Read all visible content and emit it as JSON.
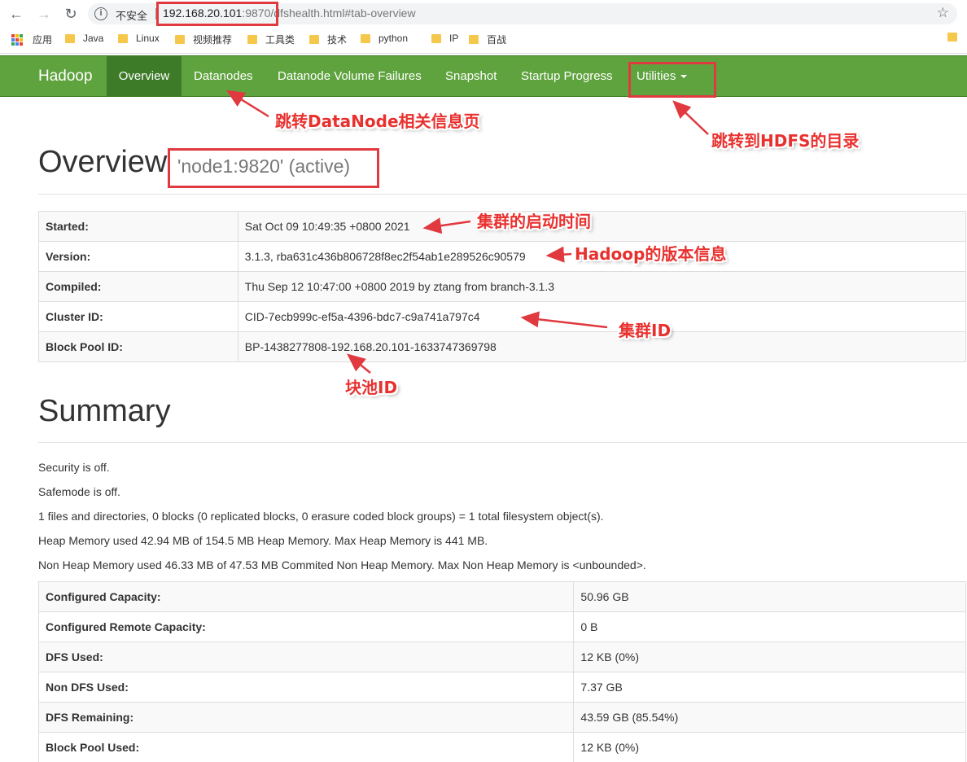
{
  "browser": {
    "insecure_label": "不安全",
    "url_host": "192.168.20.101",
    "url_port": ":9870",
    "url_path": "/dfshealth.html#tab-overview",
    "bookmarks": [
      "应用",
      "Java",
      "Linux",
      "视频推荐",
      "工具类",
      "技术",
      "python",
      "IP",
      "百战"
    ]
  },
  "navbar": {
    "brand": "Hadoop",
    "items": [
      "Overview",
      "Datanodes",
      "Datanode Volume Failures",
      "Snapshot",
      "Startup Progress",
      "Utilities"
    ],
    "active": "Overview"
  },
  "overview": {
    "title": "Overview",
    "subtitle": "'node1:9820' (active)",
    "rows": [
      {
        "key": "Started:",
        "value": "Sat Oct 09 10:49:35 +0800 2021"
      },
      {
        "key": "Version:",
        "value": "3.1.3, rba631c436b806728f8ec2f54ab1e289526c90579"
      },
      {
        "key": "Compiled:",
        "value": "Thu Sep 12 10:47:00 +0800 2019 by ztang from branch-3.1.3"
      },
      {
        "key": "Cluster ID:",
        "value": "CID-7ecb999c-ef5a-4396-bdc7-c9a741a797c4"
      },
      {
        "key": "Block Pool ID:",
        "value": "BP-1438277808-192.168.20.101-1633747369798"
      }
    ]
  },
  "summary": {
    "title": "Summary",
    "lines": [
      "Security is off.",
      "Safemode is off.",
      "1 files and directories, 0 blocks (0 replicated blocks, 0 erasure coded block groups) = 1 total filesystem object(s).",
      "Heap Memory used 42.94 MB of 154.5 MB Heap Memory. Max Heap Memory is 441 MB.",
      "Non Heap Memory used 46.33 MB of 47.53 MB Commited Non Heap Memory. Max Non Heap Memory is <unbounded>."
    ],
    "rows": [
      {
        "key": "Configured Capacity:",
        "value": "50.96 GB"
      },
      {
        "key": "Configured Remote Capacity:",
        "value": "0 B"
      },
      {
        "key": "DFS Used:",
        "value": "12 KB (0%)"
      },
      {
        "key": "Non DFS Used:",
        "value": "7.37 GB"
      },
      {
        "key": "DFS Remaining:",
        "value": "43.59 GB (85.54%)"
      },
      {
        "key": "Block Pool Used:",
        "value": "12 KB (0%)"
      }
    ]
  },
  "annotations": {
    "datanodes": "跳转DataNode相关信息页",
    "utilities": "跳转到HDFS的目录",
    "started": "集群的启动时间",
    "version": "Hadoop的版本信息",
    "cluster_id": "集群ID",
    "block_pool": "块池ID"
  },
  "colors": {
    "navbar": "#5fa33e",
    "navbar_active": "#3d7b29",
    "annotation_red": "#e8312f"
  }
}
